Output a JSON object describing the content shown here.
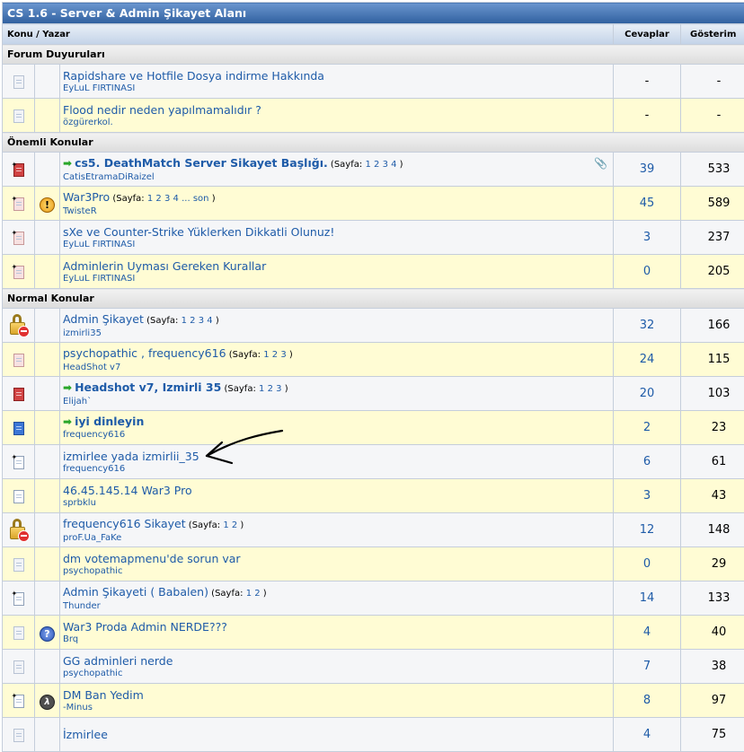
{
  "forum": {
    "title": "CS 1.6 - Server & Admin Şikayet Alanı",
    "columns": {
      "topic": "Konu / Yazar",
      "replies": "Cevaplar",
      "views": "Gösterim"
    },
    "page_label": "Sayfa:",
    "sections": [
      {
        "title": "Forum Duyuruları",
        "threads": [
          {
            "title": "Rapidshare ve Hotfile Dosya indirme Hakkında",
            "author": "EyLuL FIRTINASI",
            "replies": "-",
            "views": "-",
            "icon": "doc-faint-icon",
            "prefix": "",
            "pages": [],
            "bold": false,
            "arrow": false,
            "clip": false
          },
          {
            "title": "Flood nedir neden yapılmamalıdır ?",
            "author": "özgürerkol.",
            "replies": "-",
            "views": "-",
            "icon": "doc-faint-icon",
            "prefix": "",
            "pages": [],
            "bold": false,
            "arrow": false,
            "clip": false
          }
        ]
      },
      {
        "title": "Önemli Konular",
        "threads": [
          {
            "title": "cs5. DeathMatch Server Sikayet Başlığı.",
            "author": "CatisEtramaDiRaizel",
            "replies": "39",
            "views": "533",
            "icon": "doc-hot-new-icon",
            "prefix": "",
            "pages": [
              "1",
              "2",
              "3",
              "4"
            ],
            "bold": true,
            "arrow": true,
            "clip": true
          },
          {
            "title": "War3Pro",
            "author": "TwisteR",
            "replies": "45",
            "views": "589",
            "icon": "doc-hot-new-light-icon",
            "prefix": "warning-icon",
            "pages": [
              "1",
              "2",
              "3",
              "4",
              "...",
              "son"
            ],
            "bold": false,
            "arrow": false,
            "clip": false
          },
          {
            "title": "sXe ve Counter-Strike Yüklerken Dikkatli Olunuz!",
            "author": "EyLuL FIRTINASI",
            "replies": "3",
            "views": "237",
            "icon": "doc-hot-new-light-icon",
            "prefix": "",
            "pages": [],
            "bold": false,
            "arrow": false,
            "clip": false
          },
          {
            "title": "Adminlerin Uyması Gereken Kurallar",
            "author": "EyLuL FIRTINASI",
            "replies": "0",
            "views": "205",
            "icon": "doc-hot-new-light-icon",
            "prefix": "",
            "pages": [],
            "bold": false,
            "arrow": false,
            "clip": false
          }
        ]
      },
      {
        "title": "Normal Konular",
        "threads": [
          {
            "title": "Admin Şikayet",
            "author": "izmirli35",
            "replies": "32",
            "views": "166",
            "icon": "lock-icon",
            "prefix": "",
            "pages": [
              "1",
              "2",
              "3",
              "4"
            ],
            "bold": false,
            "arrow": false,
            "clip": false
          },
          {
            "title": "psychopathic , frequency616",
            "author": "HeadShot v7",
            "replies": "24",
            "views": "115",
            "icon": "doc-hot-icon",
            "prefix": "",
            "pages": [
              "1",
              "2",
              "3"
            ],
            "bold": false,
            "arrow": false,
            "clip": false
          },
          {
            "title": "Headshot v7, Izmirli 35",
            "author": "Elijah`",
            "replies": "20",
            "views": "103",
            "icon": "doc-hot-dark-icon",
            "prefix": "",
            "pages": [
              "1",
              "2",
              "3"
            ],
            "bold": true,
            "arrow": true,
            "clip": false
          },
          {
            "title": "iyi dinleyin",
            "author": "frequency616",
            "replies": "2",
            "views": "23",
            "icon": "doc-blue-icon",
            "prefix": "",
            "pages": [],
            "bold": true,
            "arrow": true,
            "clip": false
          },
          {
            "title": "izmirlee yada izmirlii_35",
            "author": "frequency616",
            "replies": "6",
            "views": "61",
            "icon": "doc-new-icon",
            "prefix": "",
            "pages": [],
            "bold": false,
            "arrow": false,
            "clip": false
          },
          {
            "title": "46.45.145.14 War3 Pro",
            "author": "sprbklu",
            "replies": "3",
            "views": "43",
            "icon": "doc-icon",
            "prefix": "",
            "pages": [],
            "bold": false,
            "arrow": false,
            "clip": false
          },
          {
            "title": "frequency616 Sikayet",
            "author": "proF.Ua_FaKe",
            "replies": "12",
            "views": "148",
            "icon": "lock-icon",
            "prefix": "",
            "pages": [
              "1",
              "2"
            ],
            "bold": false,
            "arrow": false,
            "clip": false
          },
          {
            "title": "dm votemapmenu'de sorun var",
            "author": "psychopathic",
            "replies": "0",
            "views": "29",
            "icon": "doc-faint-icon",
            "prefix": "",
            "pages": [],
            "bold": false,
            "arrow": false,
            "clip": false
          },
          {
            "title": "Admin Şikayeti ( Babalen)",
            "author": "Thunder",
            "replies": "14",
            "views": "133",
            "icon": "doc-new-icon",
            "prefix": "",
            "pages": [
              "1",
              "2"
            ],
            "bold": false,
            "arrow": false,
            "clip": false
          },
          {
            "title": "War3 Proda Admin NERDE???",
            "author": "Brq",
            "replies": "4",
            "views": "40",
            "icon": "doc-faint-icon",
            "prefix": "question-icon",
            "pages": [],
            "bold": false,
            "arrow": false,
            "clip": false
          },
          {
            "title": "GG adminleri nerde",
            "author": "psychopathic",
            "replies": "7",
            "views": "38",
            "icon": "doc-faint-icon",
            "prefix": "",
            "pages": [],
            "bold": false,
            "arrow": false,
            "clip": false
          },
          {
            "title": "DM Ban Yedim",
            "author": "-Minus",
            "replies": "8",
            "views": "97",
            "icon": "doc-new-icon",
            "prefix": "halflife-icon",
            "pages": [],
            "bold": false,
            "arrow": false,
            "clip": false
          },
          {
            "title": "İzmirlee",
            "author": "",
            "replies": "4",
            "views": "75",
            "icon": "doc-faint-icon",
            "prefix": "",
            "pages": [],
            "bold": false,
            "arrow": false,
            "clip": false
          }
        ]
      }
    ]
  }
}
